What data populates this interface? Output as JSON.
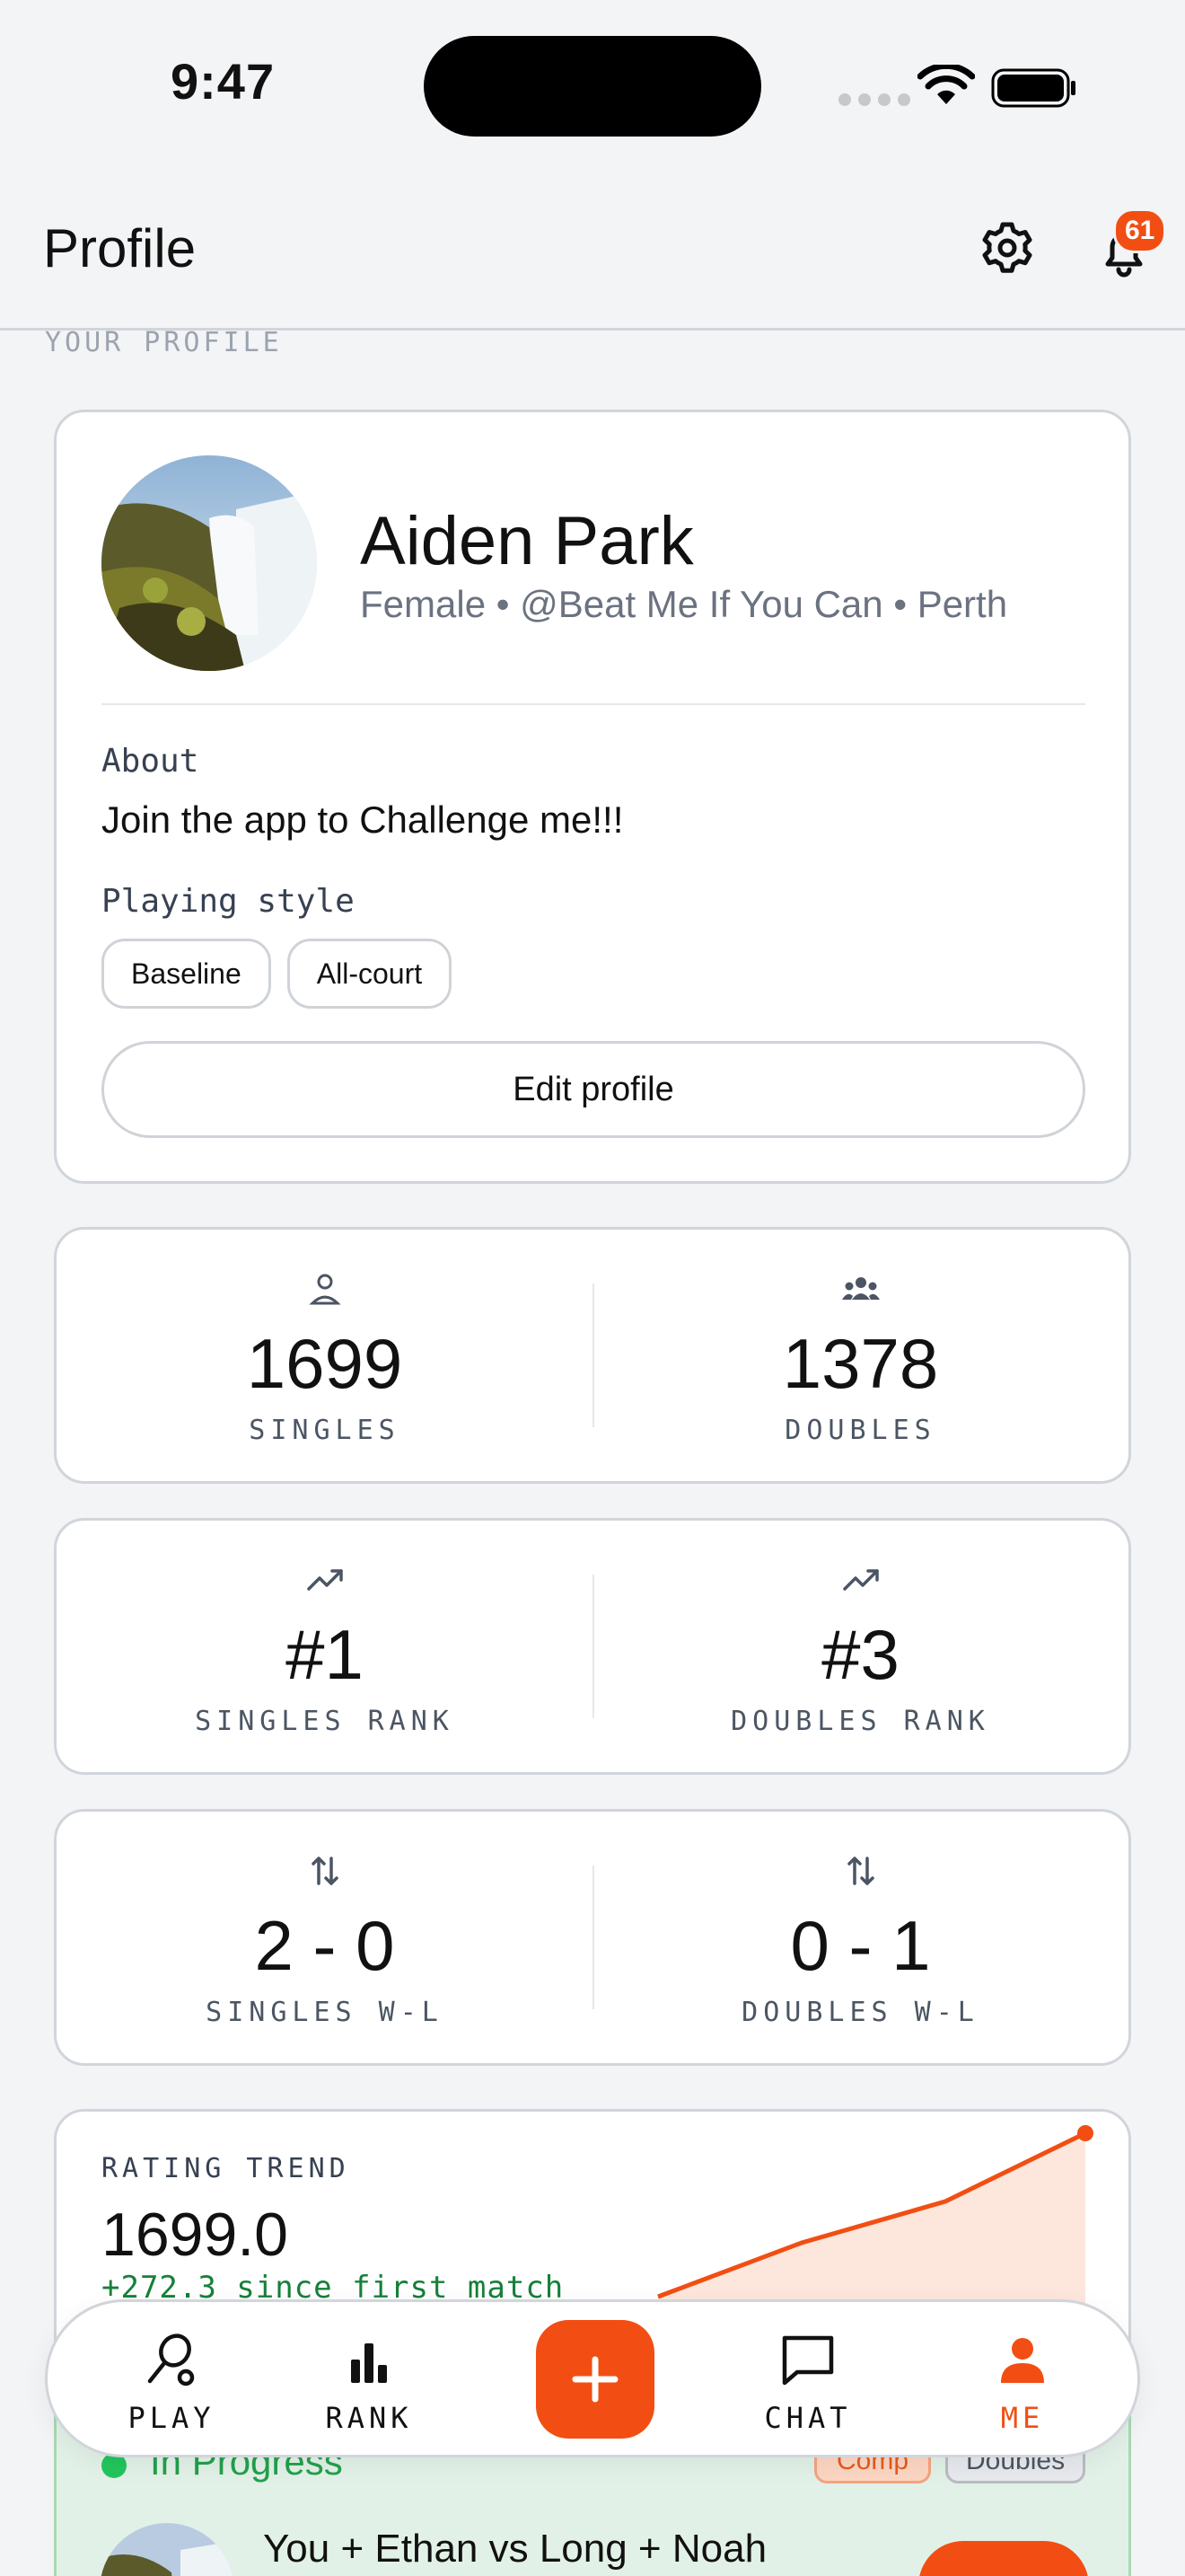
{
  "status_bar": {
    "time": "9:47"
  },
  "header": {
    "title": "Profile",
    "notification_count": "61"
  },
  "section_label": "YOUR PROFILE",
  "profile": {
    "name": "Aiden Park",
    "meta": "Female • @Beat Me If You Can • Perth",
    "about_label": "About",
    "about_text": "Join the app to Challenge me!!!",
    "playing_style_label": "Playing style",
    "styles": [
      "Baseline",
      "All-court"
    ],
    "edit_label": "Edit profile"
  },
  "ratings": {
    "singles_value": "1699",
    "singles_label": "SINGLES",
    "doubles_value": "1378",
    "doubles_label": "DOUBLES"
  },
  "ranks": {
    "singles_value": "#1",
    "singles_label": "SINGLES RANK",
    "doubles_value": "#3",
    "doubles_label": "DOUBLES RANK"
  },
  "records": {
    "singles_value": "2 - 0",
    "singles_label": "SINGLES W-L",
    "doubles_value": "0 - 1",
    "doubles_label": "DOUBLES W-L"
  },
  "rating_trend": {
    "label": "RATING TREND",
    "value": "1699.0",
    "delta": "+272.3 since first match",
    "color": "#f24e13"
  },
  "in_progress": {
    "status": "In Progress",
    "tag_comp": "Comp",
    "tag_doubles": "Doubles",
    "match_title": "You + Ethan vs Long + Noah"
  },
  "nav": {
    "play": "PLAY",
    "rank": "RANK",
    "chat": "CHAT",
    "me": "ME",
    "accent": "#f24e13"
  }
}
